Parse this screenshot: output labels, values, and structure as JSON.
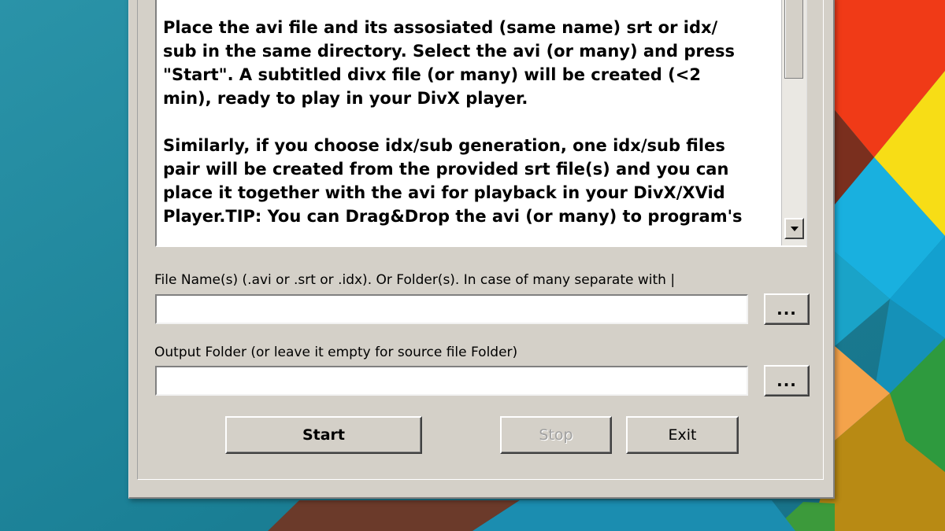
{
  "description_text": {
    "paragraph_1": "Place the avi file and its assosiated (same name) srt or idx/\nsub in the same directory. Select the avi (or many) and press\n\"Start\". A subtitled divx file (or many) will be created (<2\nmin), ready to play in your DivX player.",
    "paragraph_2": "Similarly, if you choose idx/sub generation, one idx/sub files\npair will be created from the provided srt file(s) and you can\nplace it together with the avi for playback in your DivX/XVid\nPlayer.TIP: You can Drag&Drop the avi (or many) to program's"
  },
  "file_names": {
    "label": "File Name(s) (.avi or .srt or .idx). Or Folder(s). In case of many separate with |",
    "value": "",
    "browse_label": "..."
  },
  "output_folder": {
    "label": "Output Folder (or leave it empty for source file Folder)",
    "value": "",
    "browse_label": "..."
  },
  "buttons": {
    "start": "Start",
    "stop": "Stop",
    "exit": "Exit"
  },
  "colors": {
    "dialog_face": "#d4d0c8",
    "wallpaper_teal": "#1e8fa8",
    "wallpaper_red": "#f03a17",
    "wallpaper_yellow": "#f7dd16",
    "wallpaper_cyan": "#19b0df",
    "wallpaper_green": "#2e9a3e",
    "wallpaper_orange": "#f4a34b",
    "wallpaper_brown": "#6b3a2a"
  },
  "icons": {
    "scroll_down": "arrow-down-icon"
  }
}
